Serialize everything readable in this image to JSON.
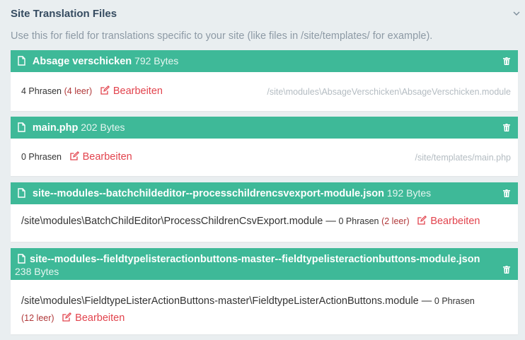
{
  "panel": {
    "title": "Site Translation Files",
    "description": "Use this for field for translations specific to your site (like files in /site/templates/ for example)."
  },
  "items": [
    {
      "filename": "Absage verschicken",
      "size": "792 Bytes",
      "phrasen": "4 Phrasen",
      "leer": "(4 leer)",
      "edit_label": "Bearbeiten",
      "path": "/site\\modules\\AbsageVerschicken\\AbsageVerschicken.module"
    },
    {
      "filename": "main.php",
      "size": "202 Bytes",
      "phrasen": "0 Phrasen",
      "leer": "",
      "edit_label": "Bearbeiten",
      "path": "/site/templates/main.php"
    },
    {
      "filename": "site--modules--batchchildeditor--processchildrencsvexport-module.json",
      "size": "192 Bytes",
      "path": "/site\\modules\\BatchChildEditor\\ProcessChildrenCsvExport.module —",
      "phrasen": "0 Phrasen",
      "leer": "(2 leer)",
      "edit_label": "Bearbeiten"
    },
    {
      "filename": "site--modules--fieldtypelisteractionbuttons-master--fieldtypelisteractionbuttons-module.json",
      "size": "238 Bytes",
      "path": "/site\\modules\\FieldtypeListerActionButtons-master\\FieldtypeListerActionButtons.module —",
      "phrasen": "0 Phrasen",
      "leer": "(12 leer)",
      "edit_label": "Bearbeiten"
    }
  ],
  "colors": {
    "header_bg": "#3eb998",
    "edit_link": "#e2434d",
    "leer": "#b0383a",
    "path_muted": "#b4bcc2"
  },
  "icons": {
    "file": "file-icon",
    "trash": "trash-icon",
    "edit": "edit-icon",
    "collapse": "chevron-down-icon"
  }
}
